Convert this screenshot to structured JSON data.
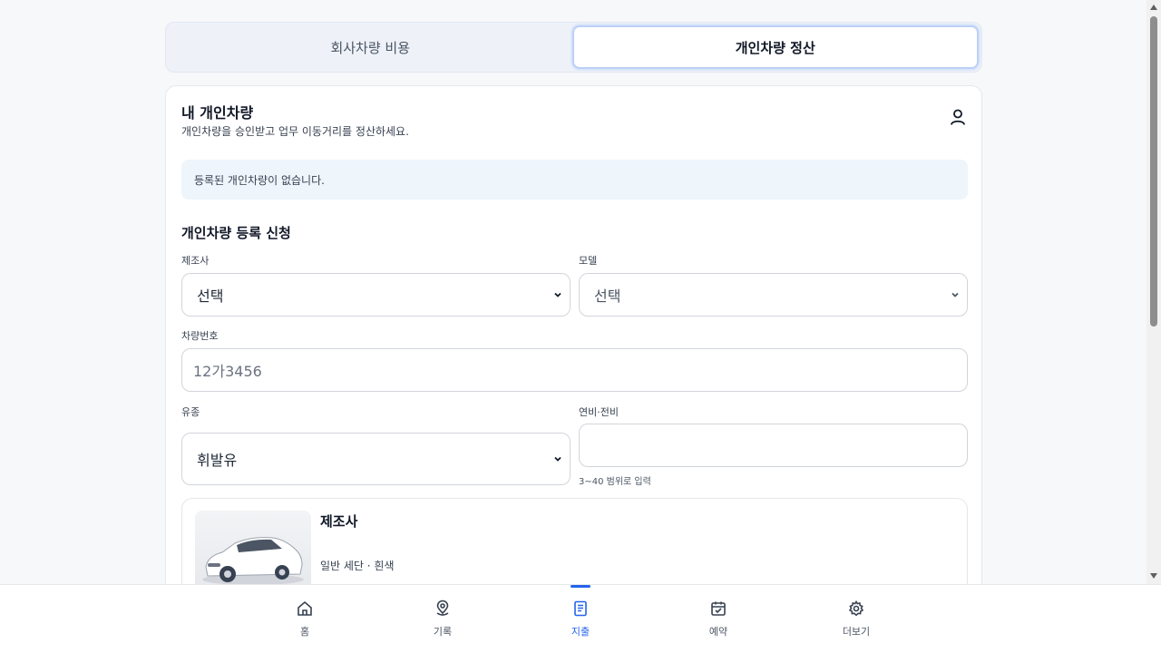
{
  "tabs": [
    {
      "label": "회사차량 비용",
      "active": false
    },
    {
      "label": "개인차량 정산",
      "active": true
    }
  ],
  "card": {
    "title": "내 개인차량",
    "subtitle": "개인차량을 승인받고 업무 이동거리를 정산하세요.",
    "notice": "등록된 개인차량이 없습니다."
  },
  "form": {
    "section_title": "개인차량 등록 신청",
    "maker": {
      "label": "제조사",
      "value": "선택"
    },
    "model": {
      "label": "모델",
      "value": "선택"
    },
    "plate": {
      "label": "차량번호",
      "placeholder": "12가3456"
    },
    "fuel": {
      "label": "유종",
      "value": "휘발유"
    },
    "efficiency": {
      "label": "연비·전비",
      "value": "",
      "hint": "3~40 범위로 입력"
    }
  },
  "car_preview": {
    "name": "제조사",
    "description": "일반 세단 · 흰색"
  },
  "bottom_nav": [
    {
      "label": "홈",
      "icon": "home-icon",
      "active": false
    },
    {
      "label": "기록",
      "icon": "location-pin-icon",
      "active": false
    },
    {
      "label": "지출",
      "icon": "receipt-icon",
      "active": true
    },
    {
      "label": "예약",
      "icon": "calendar-check-icon",
      "active": false
    },
    {
      "label": "더보기",
      "icon": "gear-icon",
      "active": false
    }
  ],
  "colors": {
    "accent": "#2563eb",
    "notice_bg": "#eef5fb",
    "tab_active_border": "#bcd0f5"
  }
}
